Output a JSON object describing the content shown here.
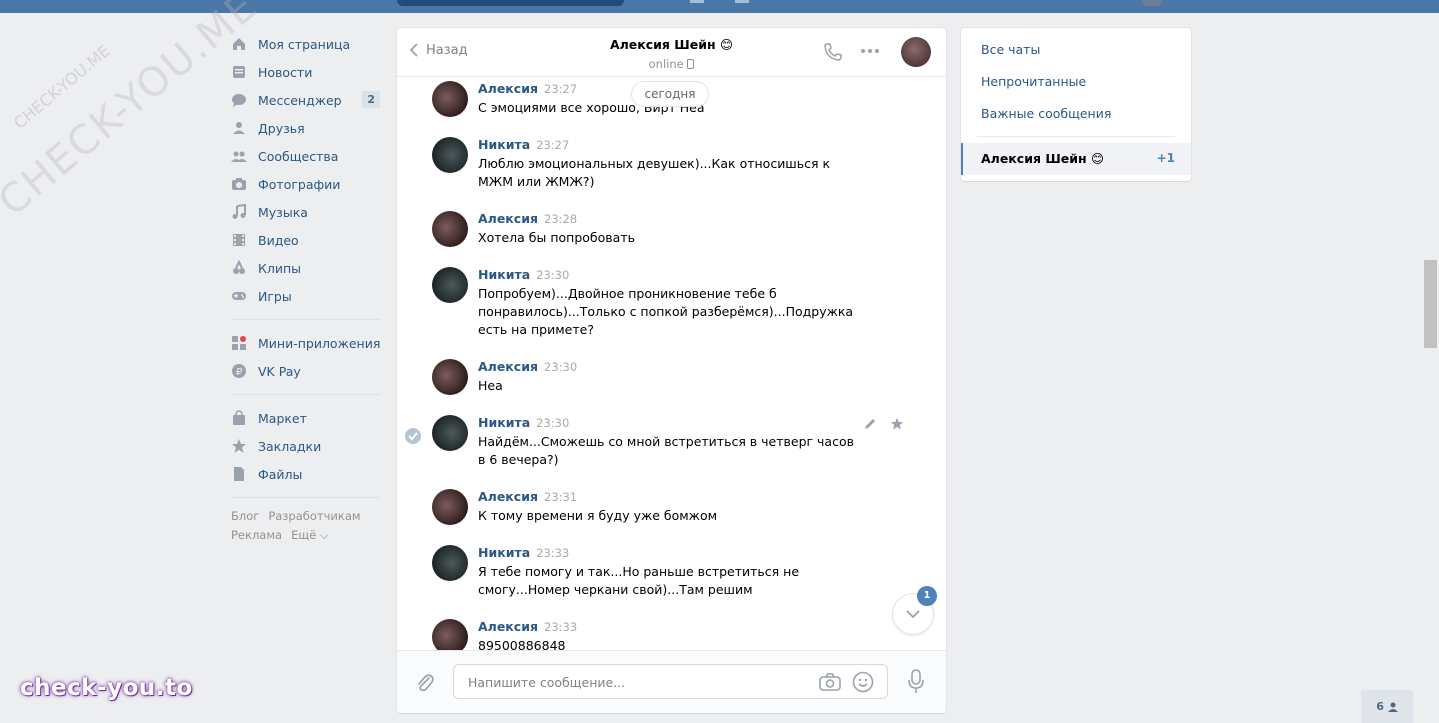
{
  "nav": {
    "items": [
      {
        "label": "Моя страница",
        "icon": "home-icon"
      },
      {
        "label": "Новости",
        "icon": "news-icon"
      },
      {
        "label": "Мессенджер",
        "icon": "messenger-icon",
        "badge": "2"
      },
      {
        "label": "Друзья",
        "icon": "friends-icon"
      },
      {
        "label": "Сообщества",
        "icon": "groups-icon"
      },
      {
        "label": "Фотографии",
        "icon": "camera-icon"
      },
      {
        "label": "Музыка",
        "icon": "music-icon"
      },
      {
        "label": "Видео",
        "icon": "video-icon"
      },
      {
        "label": "Клипы",
        "icon": "clips-icon"
      },
      {
        "label": "Игры",
        "icon": "gamepad-icon"
      }
    ],
    "items2": [
      {
        "label": "Мини-приложения",
        "icon": "apps-icon"
      },
      {
        "label": "VK Pay",
        "icon": "vkpay-icon"
      }
    ],
    "items3": [
      {
        "label": "Маркет",
        "icon": "market-icon"
      },
      {
        "label": "Закладки",
        "icon": "star-icon"
      },
      {
        "label": "Файлы",
        "icon": "file-icon"
      }
    ],
    "footer": {
      "blog": "Блог",
      "dev": "Разработчикам",
      "ads": "Реклама",
      "more": "Ещё ⌵"
    }
  },
  "chat": {
    "back_label": "Назад",
    "peer_name": "Алексия Шейн 😊",
    "peer_status": "online",
    "date_pill": "сегодня",
    "unread_count": "1",
    "messages": [
      {
        "author": "Алексия",
        "time": "23:27",
        "text": "С эмоциями все хорошо, Вирт Неа",
        "who": "alexia"
      },
      {
        "author": "Никита",
        "time": "23:27",
        "text": "Люблю эмоциональных девушек)...Как относишься к МЖМ или ЖМЖ?)",
        "who": "nikita"
      },
      {
        "author": "Алексия",
        "time": "23:28",
        "text": "Хотела бы попробовать",
        "who": "alexia"
      },
      {
        "author": "Никита",
        "time": "23:30",
        "text": "Попробуем)...Двойное проникновение тебе б понравилось)...Только с попкой разберёмся)...Подружка есть на примете?",
        "who": "nikita"
      },
      {
        "author": "Алексия",
        "time": "23:30",
        "text": "Неа",
        "who": "alexia"
      },
      {
        "author": "Никита",
        "time": "23:30",
        "text": "Найдём...Сможешь со мной встретиться в четверг часов в 6 вечера?)",
        "who": "nikita"
      },
      {
        "author": "Алексия",
        "time": "23:31",
        "text": "К тому времени я буду уже бомжом",
        "who": "alexia"
      },
      {
        "author": "Никита",
        "time": "23:33",
        "text": "Я тебе помогу и так...Но раньше встретиться не смогу...Номер черкани свой)...Там решим",
        "who": "nikita"
      },
      {
        "author": "Алексия",
        "time": "23:33",
        "text": "89500886848",
        "who": "alexia"
      }
    ],
    "composer": {
      "placeholder": "Напишите сообщение..."
    }
  },
  "right": {
    "all": "Все чаты",
    "unread": "Непрочитанные",
    "important": "Важные сообщения",
    "active_name": "Алексия Шейн 😊",
    "active_count": "+1"
  },
  "bottom_count": "6",
  "watermarks": {
    "big": "CHECK-YOU.ME",
    "small": "CHECK-YOU.ME",
    "brand": "check-you.to"
  },
  "colors": {
    "accent": "#5181b8",
    "link": "#2a5885",
    "topbar": "#4a76a8",
    "bg": "#edeef0"
  }
}
